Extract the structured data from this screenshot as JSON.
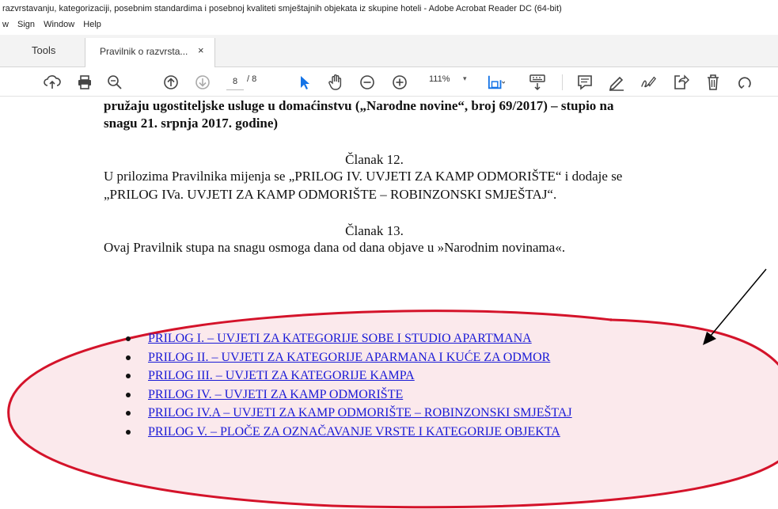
{
  "window": {
    "title": "razvrstavanju, kategorizaciji, posebnim standardima i posebnoj kvaliteti smještajnih objekata iz skupine hoteli - Adobe Acrobat Reader DC (64-bit)"
  },
  "menu": [
    "w",
    "Sign",
    "Window",
    "Help"
  ],
  "tabs": {
    "tools": "Tools",
    "document": "Pravilnik o razvrsta...",
    "close": "×"
  },
  "toolbar": {
    "current_page": "8",
    "total_pages": "/ 8",
    "zoom": "111%",
    "zoom_caret": "▾"
  },
  "document": {
    "top_line1": "pružaju ugostiteljske usluge u domaćinstvu („Narodne novine“, broj  69/2017) – stupio na",
    "top_line2": "snagu 21. srpnja 2017. godine)",
    "article12": {
      "heading": "Članak 12.",
      "line1": "U prilozima Pravilnika mijenja se „PRILOG IV. UVJETI ZA KAMP ODMORIŠTE“ i dodaje se",
      "line2": "„PRILOG IVa. UVJETI ZA KAMP ODMORIŠTE – ROBINZONSKI SMJEŠTAJ“."
    },
    "article13": {
      "heading": "Članak 13.",
      "line1": "Ovaj Pravilnik stupa na snagu osmoga dana od dana objave u »Narodnim novinama«."
    },
    "links": [
      "PRILOG I. – UVJETI ZA KATEGORIJE SOBE I STUDIO APARTMANA",
      "PRILOG II. – UVJETI ZA KATEGORIJE APARMANA I KUĆE ZA ODMOR",
      "PRILOG III. – UVJETI ZA KATEGORIJE KAMPA",
      "PRILOG IV. – UVJETI ZA KAMP ODMORIŠTE",
      "PRILOG IV.A – UVJETI ZA KAMP ODMORIŠTE – ROBINZONSKI SMJEŠTAJ",
      "PRILOG V. – PLOČE ZA OZNAČAVANJE VRSTE I KATEGORIJE OBJEKTA"
    ]
  },
  "annotation": {
    "ellipse_color": "#d4132a",
    "ellipse_fill": "#fbe9ec",
    "arrow_color": "#000000"
  },
  "colors": {
    "link": "#1a1ad6",
    "select_tool": "#1473e6"
  }
}
